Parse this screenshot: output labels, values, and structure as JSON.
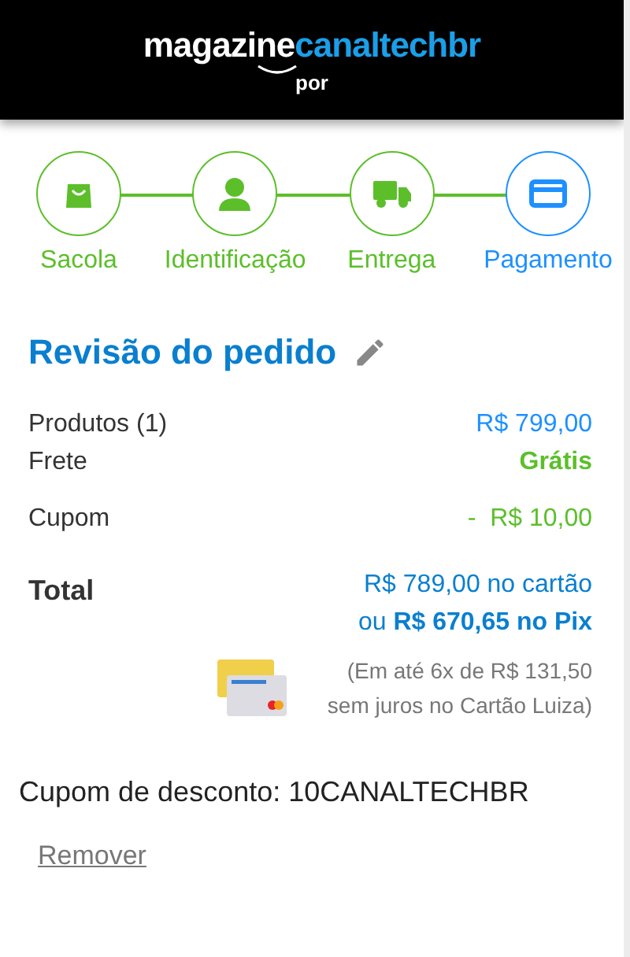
{
  "header": {
    "logo_part_1": "magazine",
    "logo_part_2": "canaltechbr",
    "byline": "por"
  },
  "steps": [
    {
      "label": "Sacola",
      "kind": "bag",
      "selected": false
    },
    {
      "label": "Identificação",
      "kind": "person",
      "selected": false
    },
    {
      "label": "Entrega",
      "kind": "truck",
      "selected": false
    },
    {
      "label": "Pagamento",
      "kind": "card",
      "selected": true
    }
  ],
  "review": {
    "title": "Revisão do pedido",
    "rows": [
      {
        "label": "Produtos (1)",
        "value": "R$ 799,00",
        "kind": "price"
      },
      {
        "label": "Frete",
        "value": "Grátis",
        "kind": "free"
      },
      {
        "label": "Cupom",
        "value": "-  R$ 10,00",
        "kind": "discount"
      }
    ],
    "total": {
      "label": "Total",
      "card_price": "R$ 789,00 no cartão",
      "pix_price": "ou **R$ 670,65 no Pix**",
      "installments": [
        "(Em até 6x de R$ 131,50",
        "sem juros no Cartão Luiza)"
      ]
    }
  },
  "coupon": {
    "text": "Cupom de desconto: 10CANALTECHBR",
    "remove_link": "Remover"
  }
}
